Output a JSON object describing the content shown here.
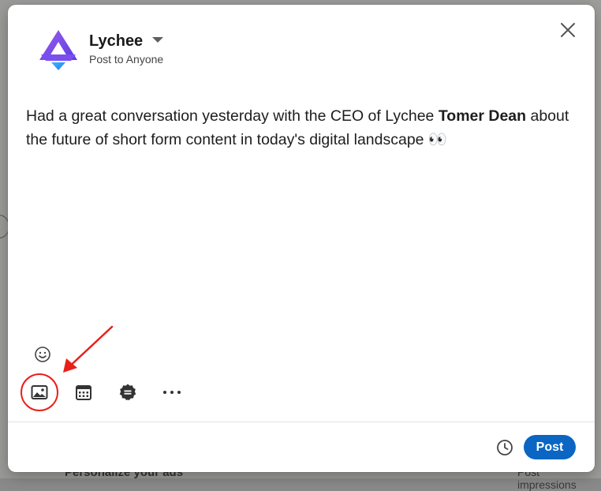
{
  "composer": {
    "author_name": "Lychee",
    "audience": "Post to Anyone",
    "text_before": "Had a great conversation yesterday with the CEO of Lychee ",
    "mention": "Tomer Dean",
    "text_after": " about the future of short form content in today's digital landscape 👀"
  },
  "footer": {
    "post_label": "Post"
  },
  "background": {
    "peek_left": "Personalize your ads",
    "peek_right": "Post impressions"
  },
  "colors": {
    "accent": "#0a66c2",
    "annotation": "#e8201a",
    "logo_purple": "#7b4fe0",
    "logo_blue": "#2f9bf3"
  },
  "icons": [
    "lychee-logo-icon",
    "caret-down-icon",
    "close-icon",
    "emoji-icon",
    "photo-icon",
    "calendar-icon",
    "badge-icon",
    "more-icon",
    "clock-icon"
  ]
}
